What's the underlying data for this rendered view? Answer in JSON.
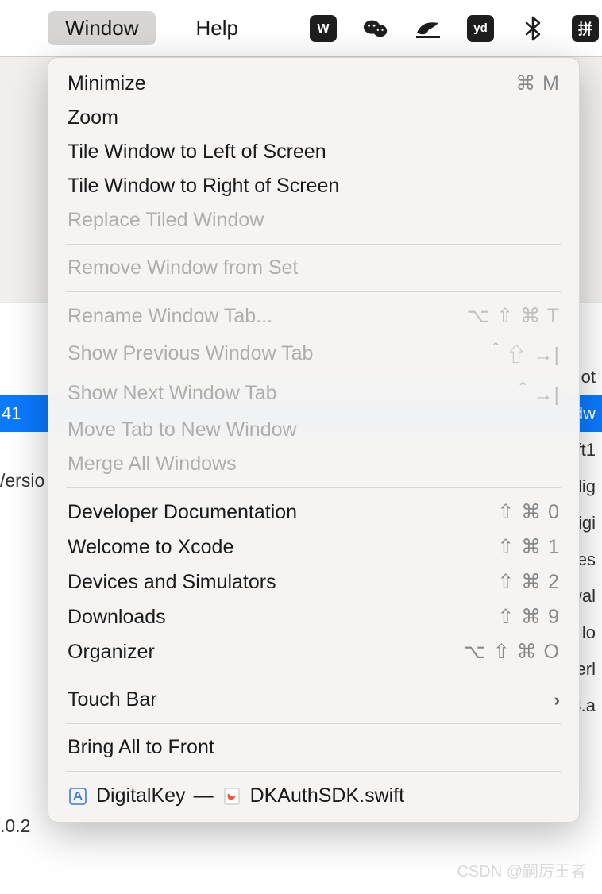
{
  "menubar": {
    "window_label": "Window",
    "help_label": "Help",
    "tray": {
      "wps": "W",
      "wechat": "wechat",
      "bird": "bird",
      "yd": "yd",
      "bluetooth": "bt",
      "pinyin": "拼"
    }
  },
  "background": {
    "versio_text": "/ersio",
    "row_41": "41",
    "row_02": ".0.2",
    "right_frags": [
      "ot",
      "dw",
      "ft1",
      "lig",
      "igi",
      "es",
      "val",
      "lo",
      "erl",
      "3.a"
    ]
  },
  "menu": {
    "items": [
      {
        "label": "Minimize",
        "shortcut": "⌘ M",
        "enabled": true
      },
      {
        "label": "Zoom",
        "shortcut": "",
        "enabled": true
      },
      {
        "label": "Tile Window to Left of Screen",
        "shortcut": "",
        "enabled": true
      },
      {
        "label": "Tile Window to Right of Screen",
        "shortcut": "",
        "enabled": true
      },
      {
        "label": "Replace Tiled Window",
        "shortcut": "",
        "enabled": false
      }
    ],
    "items2": [
      {
        "label": "Remove Window from Set",
        "shortcut": "",
        "enabled": false
      }
    ],
    "items3": [
      {
        "label": "Rename Window Tab...",
        "shortcut": "⌥ ⇧ ⌘ T",
        "enabled": false
      },
      {
        "label": "Show Previous Window Tab",
        "shortcut": "＾⇧ →|",
        "enabled": false
      },
      {
        "label": "Show Next Window Tab",
        "shortcut": "＾→|",
        "enabled": false
      },
      {
        "label": "Move Tab to New Window",
        "shortcut": "",
        "enabled": false
      },
      {
        "label": "Merge All Windows",
        "shortcut": "",
        "enabled": false
      }
    ],
    "items4": [
      {
        "label": "Developer Documentation",
        "shortcut": "⇧ ⌘ 0",
        "enabled": true
      },
      {
        "label": "Welcome to Xcode",
        "shortcut": "⇧ ⌘ 1",
        "enabled": true
      },
      {
        "label": "Devices and Simulators",
        "shortcut": "⇧ ⌘ 2",
        "enabled": true
      },
      {
        "label": "Downloads",
        "shortcut": "⇧ ⌘ 9",
        "enabled": true
      },
      {
        "label": "Organizer",
        "shortcut": "⌥ ⇧ ⌘ O",
        "enabled": true
      }
    ],
    "touchbar": {
      "label": "Touch Bar",
      "arrow": "›"
    },
    "bring_front": {
      "label": "Bring All to Front"
    },
    "window_entry": {
      "project_name": "DigitalKey",
      "separator": "—",
      "file_name": "DKAuthSDK.swift"
    }
  },
  "watermark": "CSDN @嗣厉王者"
}
